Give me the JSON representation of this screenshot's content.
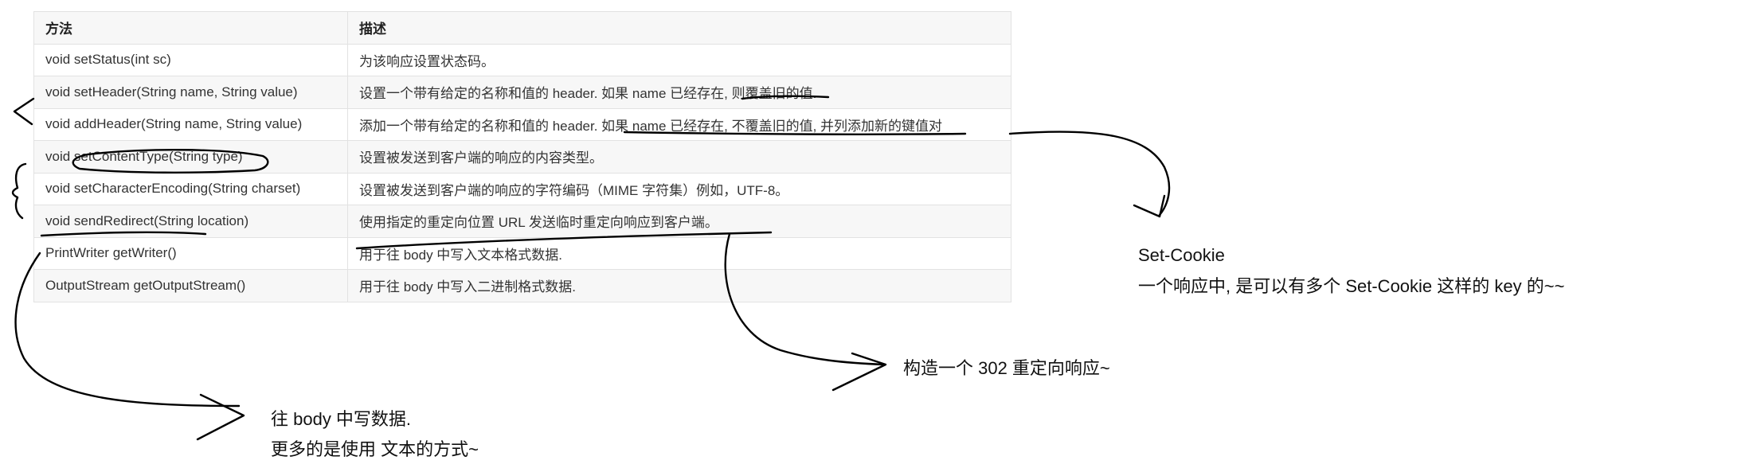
{
  "table": {
    "headers": [
      "方法",
      "描述"
    ],
    "rows": [
      {
        "method": "void setStatus(int sc)",
        "desc": "为该响应设置状态码。"
      },
      {
        "method": "void setHeader(String name, String value)",
        "desc": "设置一个带有给定的名称和值的 header. 如果 name 已经存在, 则覆盖旧的值."
      },
      {
        "method": "void addHeader(String name, String value)",
        "desc": "添加一个带有给定的名称和值的 header. 如果 name 已经存在, 不覆盖旧的值, 并列添加新的键值对"
      },
      {
        "method": "void setContentType(String type)",
        "desc": "设置被发送到客户端的响应的内容类型。"
      },
      {
        "method": "void setCharacterEncoding(String charset)",
        "desc": "设置被发送到客户端的响应的字符编码（MIME 字符集）例如，UTF-8。"
      },
      {
        "method": "void sendRedirect(String location)",
        "desc": "使用指定的重定向位置 URL 发送临时重定向响应到客户端。"
      },
      {
        "method": "PrintWriter getWriter()",
        "desc": "用于往 body 中写入文本格式数据."
      },
      {
        "method": "OutputStream getOutputStream()",
        "desc": "用于往 body 中写入二进制格式数据."
      }
    ]
  },
  "notes": {
    "cookie_title": "Set-Cookie",
    "cookie_body": "一个响应中, 是可以有多个 Set-Cookie 这样的 key 的~~",
    "redirect": "构造一个 302 重定向响应~",
    "body_line1": "往 body 中写数据.",
    "body_line2": "更多的是使用 文本的方式~"
  }
}
